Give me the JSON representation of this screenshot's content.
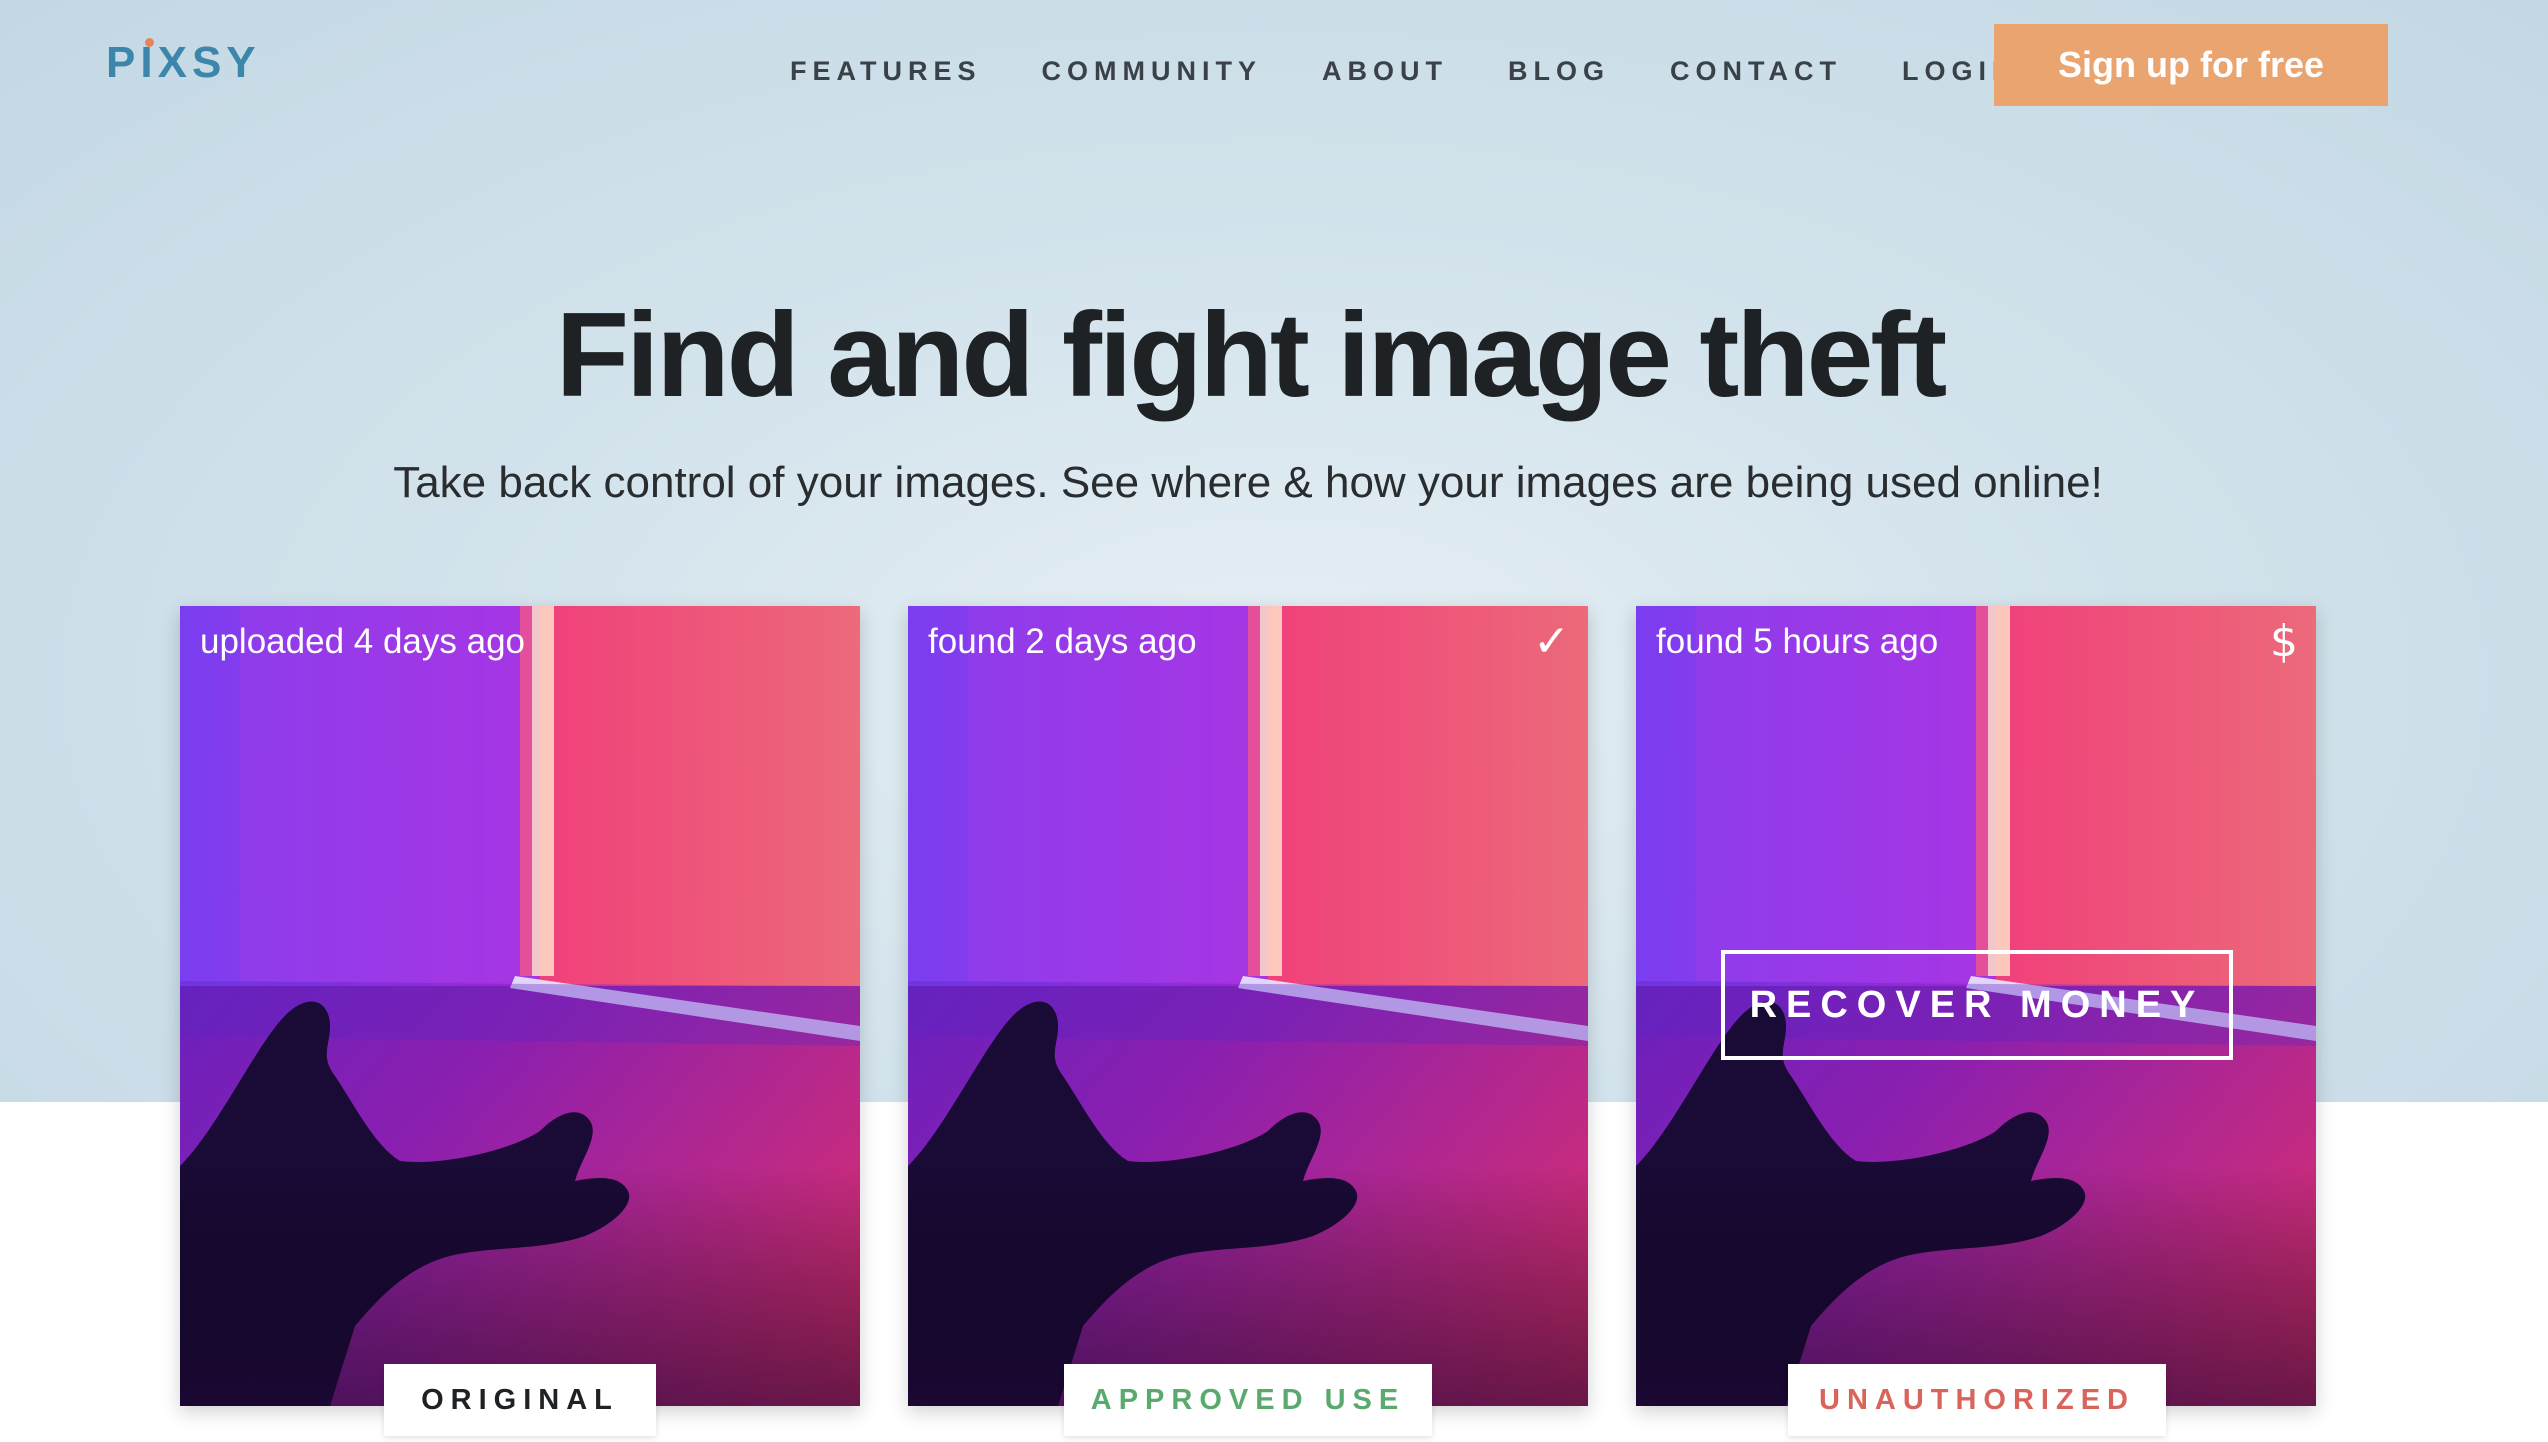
{
  "brand": {
    "logo_text": "PIXSY",
    "logo_color": "#3d86ab",
    "logo_dot_color": "#e8845a"
  },
  "nav": {
    "items": [
      {
        "label": "FEATURES"
      },
      {
        "label": "COMMUNITY"
      },
      {
        "label": "ABOUT"
      },
      {
        "label": "BLOG"
      },
      {
        "label": "CONTACT"
      },
      {
        "label": "LOGIN"
      }
    ],
    "cta_label": "Sign up for free",
    "cta_color": "#e9a46f"
  },
  "hero": {
    "headline": "Find and fight image theft",
    "subheadline": "Take back control of your images. See where & how your images are being used online!"
  },
  "cards": [
    {
      "time": "uploaded 4 days ago",
      "icon": "",
      "tag": "ORIGINAL",
      "tag_color": "#1f2224"
    },
    {
      "time": "found 2 days ago",
      "icon": "✓",
      "icon_name": "check-icon",
      "tag": "APPROVED USE",
      "tag_color": "#5aaa6e"
    },
    {
      "time": "found 5 hours ago",
      "icon": "$",
      "icon_name": "dollar-icon",
      "tag": "UNAUTHORIZED",
      "tag_color": "#d9645c",
      "action_label": "RECOVER MONEY"
    }
  ]
}
